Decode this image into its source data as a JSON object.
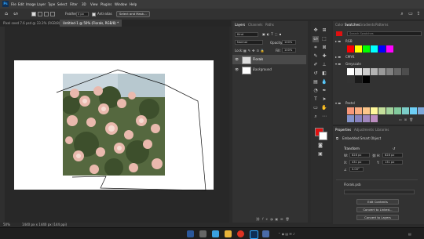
{
  "app": {
    "logo": "Ps"
  },
  "menu": [
    "File",
    "Edit",
    "Image",
    "Layer",
    "Type",
    "Select",
    "Filter",
    "3D",
    "View",
    "Plugins",
    "Window",
    "Help"
  ],
  "options_bar": {
    "feather_label": "Feather:",
    "feather_value": "0 px",
    "antialias_label": "Anti-alias",
    "select_mask_label": "Select and Mask..."
  },
  "doc_tabs": [
    {
      "label": "Pixel seed 7.6 psd @ 33.3% (RGB/8) *"
    },
    {
      "label": "Untitled-1 @ 50% (Florals, RGB/8) *"
    }
  ],
  "status": {
    "zoom": "50%",
    "doc_size": "1440 px x 1440 px (144 ppi)"
  },
  "layers_panel": {
    "tabs": [
      "Layers",
      "Channels",
      "Paths"
    ],
    "kind_label": "Kind",
    "blend_mode": "Normal",
    "opacity_label": "Opacity:",
    "opacity_value": "100%",
    "lock_label": "Lock:",
    "fill_label": "Fill:",
    "fill_value": "100%",
    "layers": [
      {
        "name": "Florals"
      },
      {
        "name": "Background"
      }
    ]
  },
  "swatches_panel": {
    "tabs": [
      "Color",
      "Swatches",
      "Gradients",
      "Patterns"
    ],
    "search_placeholder": "Search Swatches",
    "groups": [
      "RGB",
      "CMYK",
      "Greyscale",
      "Pastel"
    ],
    "rgb_colors": [
      "#ff0000",
      "#ffff00",
      "#00ff00",
      "#00ffff",
      "#0000ff",
      "#ff00ff"
    ],
    "cmyk_colors": [
      "#00aeef",
      "#ec008c",
      "#fff200"
    ],
    "grey_colors": [
      "#ffffff",
      "#e6e6e6",
      "#cccccc",
      "#b3b3b3",
      "#999999",
      "#808080",
      "#666666",
      "#4d4d4d",
      "#333333",
      "#1a1a1a",
      "#000000"
    ],
    "pastel_colors": [
      "#f7977a",
      "#f9ad81",
      "#fdc68a",
      "#fff79a",
      "#c4df9b",
      "#a2d39c",
      "#82ca9d",
      "#7bcdc8",
      "#6ecff6",
      "#7ea7d8",
      "#8493ca",
      "#8882be",
      "#a187be",
      "#bc8dbf"
    ]
  },
  "properties_panel": {
    "tabs": [
      "Properties",
      "Adjustments",
      "Libraries"
    ],
    "object_type": "Embedded Smart Object",
    "transform_title": "Transform",
    "w_label": "W:",
    "w_value": "828 px",
    "h_label": "H:",
    "h_value": "828 px",
    "x_label": "X:",
    "x_value": "431 px",
    "y_label": "Y:",
    "y_value": "131 px",
    "angle_value": "0.00°",
    "file_label": "Florals.psb",
    "buttons": [
      "Edit Contents",
      "Convert to Linked...",
      "Convert to Layers"
    ]
  },
  "colors": {
    "foreground": "#e01010",
    "background": "#ffffff",
    "accent": "#31a8ff"
  }
}
